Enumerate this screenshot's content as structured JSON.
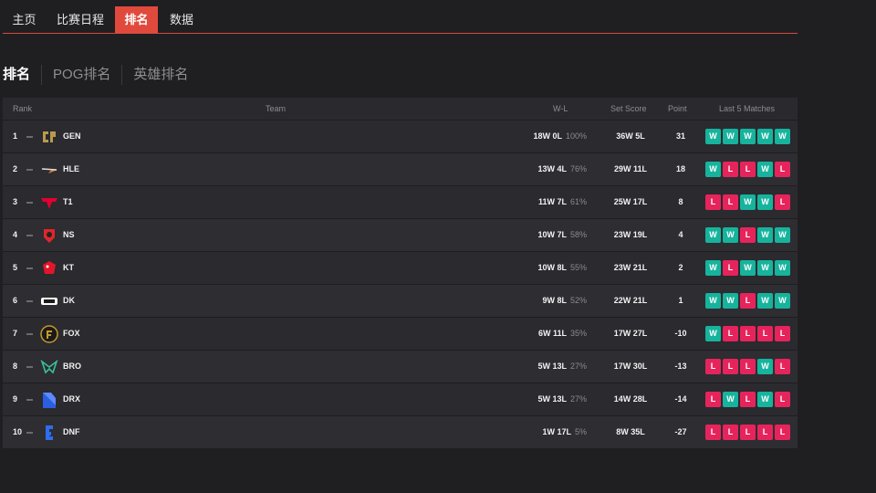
{
  "nav": {
    "tabs": [
      {
        "label": "主页",
        "active": false
      },
      {
        "label": "比赛日程",
        "active": false
      },
      {
        "label": "排名",
        "active": true
      },
      {
        "label": "数据",
        "active": false
      }
    ]
  },
  "subnav": {
    "tabs": [
      {
        "label": "排名",
        "active": true
      },
      {
        "label": "POG排名",
        "active": false
      },
      {
        "label": "英雄排名",
        "active": false
      }
    ]
  },
  "table": {
    "headers": {
      "rank": "Rank",
      "team": "Team",
      "wl": "W-L",
      "set_score": "Set Score",
      "point": "Point",
      "last5": "Last 5 Matches"
    },
    "rows": [
      {
        "rank": "1",
        "team": "GEN",
        "logo": "gen-logo",
        "wl": "18W 0L",
        "pct": "100%",
        "set": "36W 5L",
        "pts": "31",
        "last5": [
          "W",
          "W",
          "W",
          "W",
          "W"
        ]
      },
      {
        "rank": "2",
        "team": "HLE",
        "logo": "hle-logo",
        "wl": "13W 4L",
        "pct": "76%",
        "set": "29W 11L",
        "pts": "18",
        "last5": [
          "W",
          "L",
          "L",
          "W",
          "L"
        ]
      },
      {
        "rank": "3",
        "team": "T1",
        "logo": "t1-logo",
        "wl": "11W 7L",
        "pct": "61%",
        "set": "25W 17L",
        "pts": "8",
        "last5": [
          "L",
          "L",
          "W",
          "W",
          "L"
        ]
      },
      {
        "rank": "4",
        "team": "NS",
        "logo": "ns-logo",
        "wl": "10W 7L",
        "pct": "58%",
        "set": "23W 19L",
        "pts": "4",
        "last5": [
          "W",
          "W",
          "L",
          "W",
          "W"
        ]
      },
      {
        "rank": "5",
        "team": "KT",
        "logo": "kt-logo",
        "wl": "10W 8L",
        "pct": "55%",
        "set": "23W 21L",
        "pts": "2",
        "last5": [
          "W",
          "L",
          "W",
          "W",
          "W"
        ]
      },
      {
        "rank": "6",
        "team": "DK",
        "logo": "dk-logo",
        "wl": "9W 8L",
        "pct": "52%",
        "set": "22W 21L",
        "pts": "1",
        "last5": [
          "W",
          "W",
          "L",
          "W",
          "W"
        ]
      },
      {
        "rank": "7",
        "team": "FOX",
        "logo": "fox-logo",
        "wl": "6W 11L",
        "pct": "35%",
        "set": "17W 27L",
        "pts": "-10",
        "last5": [
          "W",
          "L",
          "L",
          "L",
          "L"
        ]
      },
      {
        "rank": "8",
        "team": "BRO",
        "logo": "bro-logo",
        "wl": "5W 13L",
        "pct": "27%",
        "set": "17W 30L",
        "pts": "-13",
        "last5": [
          "L",
          "L",
          "L",
          "W",
          "L"
        ]
      },
      {
        "rank": "9",
        "team": "DRX",
        "logo": "drx-logo",
        "wl": "5W 13L",
        "pct": "27%",
        "set": "14W 28L",
        "pts": "-14",
        "last5": [
          "L",
          "W",
          "L",
          "W",
          "L"
        ]
      },
      {
        "rank": "10",
        "team": "DNF",
        "logo": "dnf-logo",
        "wl": "1W 17L",
        "pct": "5%",
        "set": "8W 35L",
        "pts": "-27",
        "last5": [
          "L",
          "L",
          "L",
          "L",
          "L"
        ]
      }
    ]
  },
  "colors": {
    "accent": "#e04a3d",
    "win": "#17b39c",
    "loss": "#e6245c"
  }
}
